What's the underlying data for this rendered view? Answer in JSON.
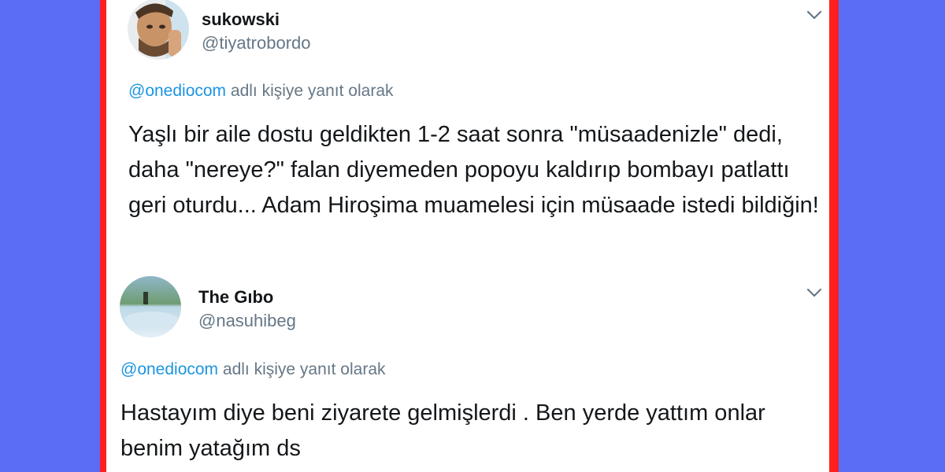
{
  "colors": {
    "background": "#5b6cf5",
    "border": "#ff1f1f",
    "card": "#ffffff",
    "text": "#14171a",
    "secondary": "#657786",
    "link": "#1b95e0"
  },
  "tweets": [
    {
      "name": "sukowski",
      "handle": "@tiyatrobordo",
      "reply_mention": "@onediocom",
      "reply_suffix": " adlı kişiye yanıt olarak",
      "text": "Yaşlı bir aile dostu geldikten 1-2 saat sonra \"müsaadenizle\" dedi, daha \"nereye?\" falan diyemeden popoyu kaldırıp bombayı patlattı geri oturdu... Adam Hiroşima muamelesi için müsaade istedi bildiğin!",
      "menu_icon": "chevron-down-icon",
      "avatar_icon": "user-avatar"
    },
    {
      "name": "The Gıbo",
      "handle": "@nasuhibeg",
      "reply_mention": "@onediocom",
      "reply_suffix": " adlı kişiye yanıt olarak",
      "text": "Hastayım diye beni ziyarete gelmişlerdi . Ben yerde yattım onlar benim yatağım ds",
      "menu_icon": "chevron-down-icon",
      "avatar_icon": "user-avatar"
    }
  ]
}
